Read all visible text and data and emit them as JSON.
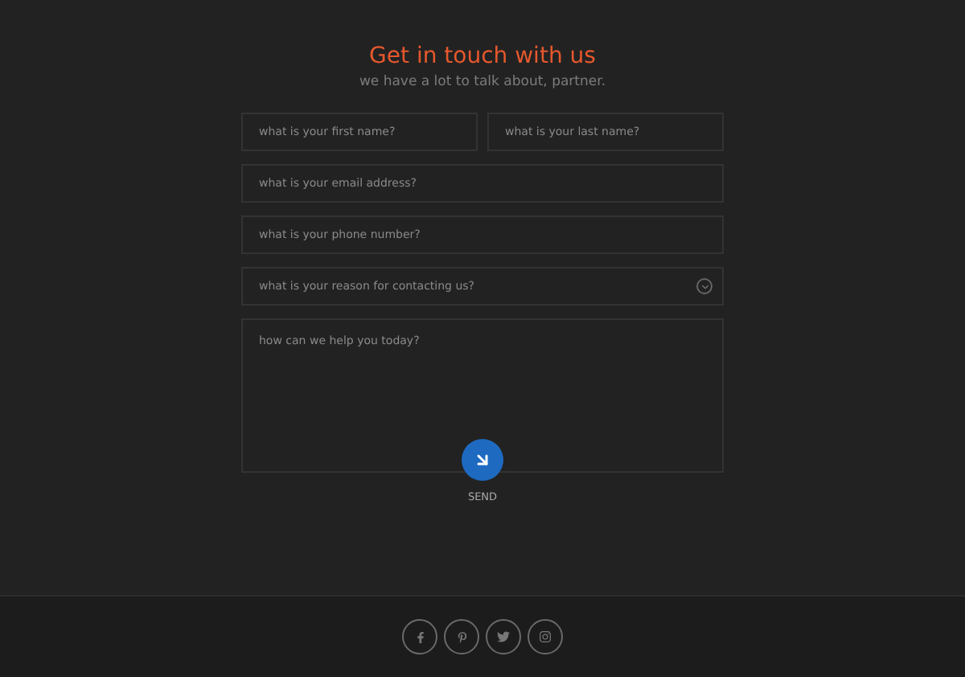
{
  "header": {
    "title": "Get in touch with us",
    "subtitle": "we have a lot to talk about, partner."
  },
  "fields": [
    {
      "kind": "text",
      "placeholder": "what is your first name?"
    },
    {
      "kind": "text",
      "placeholder": "what is your last name?"
    },
    {
      "kind": "text",
      "placeholder": "what is your email address?"
    },
    {
      "kind": "text",
      "placeholder": "what is your phone number?"
    },
    {
      "kind": "select",
      "placeholder": "what is your reason for contacting us?"
    },
    {
      "kind": "textarea",
      "placeholder": "how can we help you today?"
    }
  ],
  "send": {
    "label": "SEND"
  },
  "footer": {
    "social": [
      {
        "kind": "f"
      },
      {
        "kind": "pin"
      },
      {
        "kind": "bird"
      },
      {
        "kind": "camera"
      }
    ]
  }
}
